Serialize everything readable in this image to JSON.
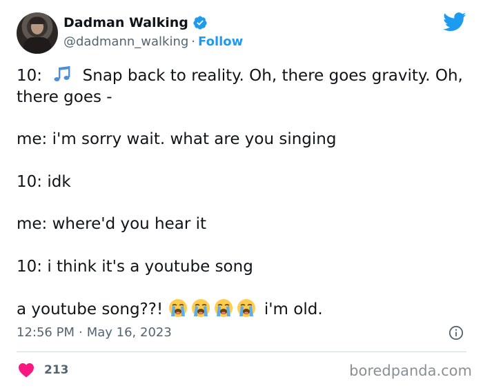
{
  "author": {
    "display_name": "Dadman Walking",
    "handle": "@dadmann_walking",
    "separator": "·",
    "follow_label": "Follow"
  },
  "tweet": {
    "line1_prefix": "10:",
    "line1_text": "Snap back to reality. Oh, there goes gravity. Oh, there goes -",
    "line2": "me: i'm sorry wait. what are you singing",
    "line3": "10: idk",
    "line4": "me: where'd you hear it",
    "line5": "10: i think it's a youtube song",
    "line6_prefix": "a youtube song??!",
    "line6_suffix": "i'm old."
  },
  "meta": {
    "time": "12:56 PM",
    "separator": "·",
    "date": "May 16, 2023"
  },
  "engagement": {
    "likes": "213"
  },
  "watermark": "boredpanda.com",
  "icons": {
    "verified": "verified-badge-icon",
    "twitter": "twitter-bird-icon",
    "music": "music-notes-icon",
    "crying": "loudly-crying-face-icon",
    "info": "info-icon",
    "like": "heart-icon"
  },
  "colors": {
    "accent": "#1d9bf0",
    "like": "#f91880",
    "secondary_text": "#536471"
  }
}
